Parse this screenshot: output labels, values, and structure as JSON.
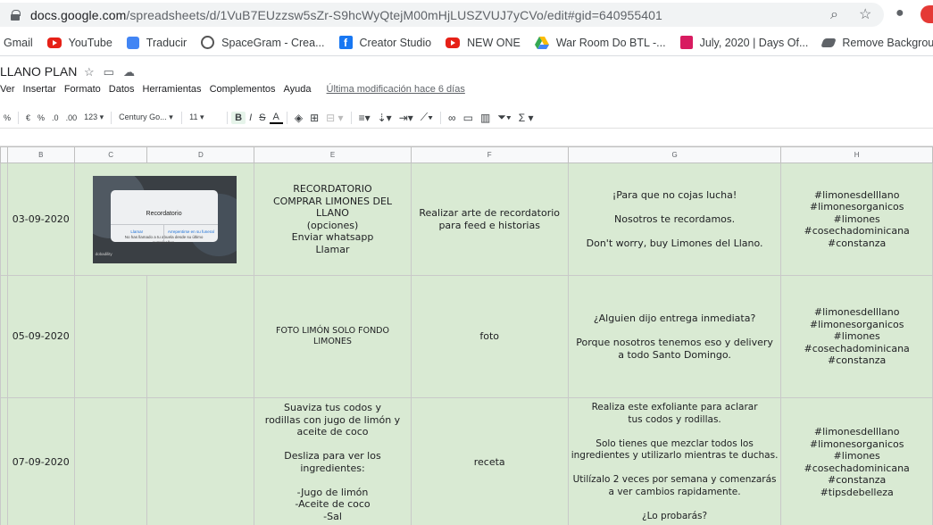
{
  "browser": {
    "url_domain": "docs.google.com",
    "url_path": "/spreadsheets/d/1VuB7EUzzsw5sZr-S9hcWyQtejM00mHjLUSZVUJ7yCVo/edit#gid=640955401",
    "bookmarks": [
      {
        "label": "Gmail",
        "icon": "gmail-icon"
      },
      {
        "label": "YouTube",
        "icon": "youtube-icon"
      },
      {
        "label": "Traducir",
        "icon": "translate-icon"
      },
      {
        "label": "SpaceGram - Crea...",
        "icon": "spacegram-icon"
      },
      {
        "label": "Creator Studio",
        "icon": "facebook-icon"
      },
      {
        "label": "NEW ONE",
        "icon": "youtube-icon"
      },
      {
        "label": "War Room Do BTL -...",
        "icon": "drive-icon"
      },
      {
        "label": "July, 2020 | Days Of...",
        "icon": "calendar-icon"
      },
      {
        "label": "Remove Backgroun...",
        "icon": "remove-bg-icon"
      }
    ]
  },
  "doc": {
    "title": "LLANO PLAN",
    "menu": [
      "Ver",
      "Insertar",
      "Formato",
      "Datos",
      "Herramientas",
      "Complementos",
      "Ayuda"
    ],
    "last_modified": "Última modificación hace 6 días"
  },
  "toolbar": {
    "percent": "%",
    "currency": "€",
    "pct": "%",
    "dec_less": ".0",
    "dec_more": ".00",
    "format_more": "123",
    "font": "Century Go...",
    "font_size": "11",
    "bold": "B",
    "italic": "I",
    "strike": "S",
    "text_color": "A"
  },
  "columns": [
    "B",
    "C",
    "D",
    "E",
    "F",
    "G",
    "H"
  ],
  "rows": [
    {
      "date": "03-09-2020",
      "image": {
        "dialog_title": "Recordatorio",
        "dialog_message": "No has llamado a tu abuela desde su último cumpleaños.",
        "btn_left": "Llamar",
        "btn_right": "Arrepentirse en su funeral",
        "watermark": "dobadility"
      },
      "e": "RECORDATORIO\nCOMPRAR LIMONES DEL\nLLANO\n(opciones)\nEnviar whatsapp\nLlamar",
      "f": "Realizar arte de recordatorio\npara feed e historias",
      "g": "¡Para que no cojas lucha!\n\nNosotros te recordamos.\n\nDon't worry, buy Limones del Llano.",
      "h": "#limonesdelllano\n#limonesorganicos\n#limones\n#cosechadominicana\n#constanza"
    },
    {
      "date": "05-09-2020",
      "e": "FOTO LIMÓN SOLO FONDO\nLIMONES",
      "f": "foto",
      "g": "¿Alguien dijo entrega inmediata?\n\nPorque nosotros tenemos eso y delivery\na todo Santo Domingo.",
      "h": "#limonesdelllano\n#limonesorganicos\n#limones\n#cosechadominicana\n#constanza"
    },
    {
      "date": "07-09-2020",
      "e": "Suaviza tus codos y\nrodillas con jugo de limón y\naceite de coco\n\nDesliza para ver los ingredientes:\n\n-Jugo de limón\n-Aceite de coco\n-Sal",
      "f": "receta",
      "g": "Realiza este exfoliante para aclarar\ntus codos y rodillas.\n\nSolo tienes que mezclar todos los\ningredientes y utilizarlo mientras te duchas.\n\nUtilízalo 2 veces por semana y comenzarás\na ver cambios rapidamente.\n\n¿Lo probarás?",
      "h": "#limonesdelllano\n#limonesorganicos\n#limones\n#cosechadominicana\n#constanza\n#tipsdebelleza"
    }
  ],
  "colors": {
    "cell_green": "#d9ead3",
    "header_bg": "#f8f9fa",
    "accent_red": "#e62117"
  }
}
